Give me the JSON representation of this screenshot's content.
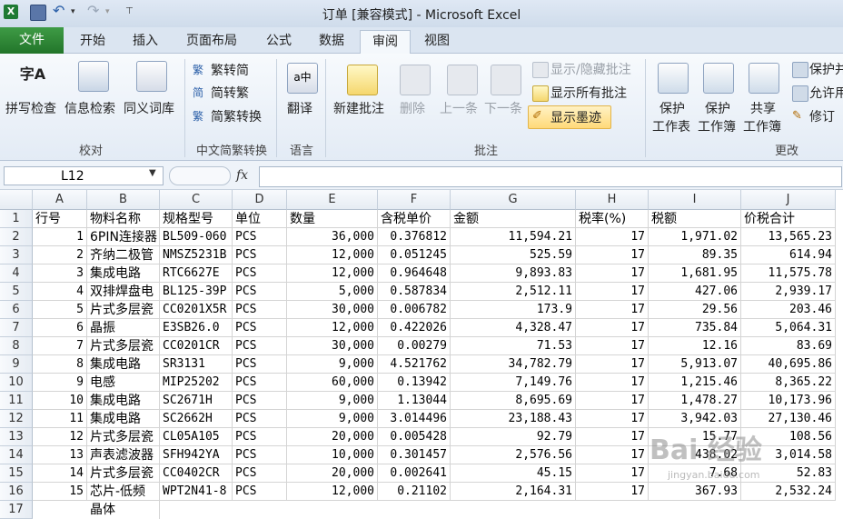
{
  "window": {
    "title": "订单 [兼容模式] - Microsoft Excel"
  },
  "tabs": [
    {
      "label": "文件"
    },
    {
      "label": "开始"
    },
    {
      "label": "插入"
    },
    {
      "label": "页面布局"
    },
    {
      "label": "公式"
    },
    {
      "label": "数据"
    },
    {
      "label": "审阅"
    },
    {
      "label": "视图"
    }
  ],
  "ribbon": {
    "proofing": {
      "spell": "拼写检查",
      "research": "信息检索",
      "thesaurus": "同义词库",
      "group": "校对"
    },
    "chinese": {
      "to_trad": "繁转简",
      "to_simp": "简转繁",
      "convert": "简繁转换",
      "group": "中文简繁转换"
    },
    "language": {
      "translate": "翻译",
      "group": "语言"
    },
    "comments": {
      "new": "新建批注",
      "delete": "删除",
      "prev": "上一条",
      "next": "下一条",
      "show_hide": "显示/隐藏批注",
      "show_all": "显示所有批注",
      "show_ink": "显示墨迹",
      "group": "批注"
    },
    "changes": {
      "protect_sheet_1": "保护",
      "protect_sheet_2": "工作表",
      "protect_wb_1": "保护",
      "protect_wb_2": "工作簿",
      "share_wb_1": "共享",
      "share_wb_2": "工作簿",
      "protect_share": "保护并",
      "allow_edit": "允许用",
      "track": "修订",
      "group": "更改"
    }
  },
  "formula_bar": {
    "name_box": "L12",
    "fx": "fx",
    "value": ""
  },
  "grid": {
    "columns": [
      "A",
      "B",
      "C",
      "D",
      "E",
      "F",
      "G",
      "H",
      "I",
      "J"
    ],
    "rows": [
      [
        "行号",
        "物料名称",
        "规格型号",
        "单位",
        "数量",
        "含税单价",
        "金额",
        "税率(%)",
        "税额",
        "价税合计"
      ],
      [
        "1",
        "6PIN连接器",
        "BL509-060",
        "PCS",
        "36,000",
        "0.376812",
        "11,594.21",
        "17",
        "1,971.02",
        "13,565.23"
      ],
      [
        "2",
        "齐纳二极管",
        "NMSZ5231B",
        "PCS",
        "12,000",
        "0.051245",
        "525.59",
        "17",
        "89.35",
        "614.94"
      ],
      [
        "3",
        "集成电路",
        "RTC6627E",
        "PCS",
        "12,000",
        "0.964648",
        "9,893.83",
        "17",
        "1,681.95",
        "11,575.78"
      ],
      [
        "4",
        "双排焊盘电",
        "BL125-39P",
        "PCS",
        "5,000",
        "0.587834",
        "2,512.11",
        "17",
        "427.06",
        "2,939.17"
      ],
      [
        "5",
        "片式多层瓷",
        "CC0201X5R",
        "PCS",
        "30,000",
        "0.006782",
        "173.9",
        "17",
        "29.56",
        "203.46"
      ],
      [
        "6",
        "晶振",
        "E3SB26.0",
        "PCS",
        "12,000",
        "0.422026",
        "4,328.47",
        "17",
        "735.84",
        "5,064.31"
      ],
      [
        "7",
        "片式多层瓷",
        "CC0201CR",
        "PCS",
        "30,000",
        "0.00279",
        "71.53",
        "17",
        "12.16",
        "83.69"
      ],
      [
        "8",
        "集成电路",
        "SR3131",
        "PCS",
        "9,000",
        "4.521762",
        "34,782.79",
        "17",
        "5,913.07",
        "40,695.86"
      ],
      [
        "9",
        "电感",
        "MIP25202",
        "PCS",
        "60,000",
        "0.13942",
        "7,149.76",
        "17",
        "1,215.46",
        "8,365.22"
      ],
      [
        "10",
        "集成电路",
        "SC2671H",
        "PCS",
        "9,000",
        "1.13044",
        "8,695.69",
        "17",
        "1,478.27",
        "10,173.96"
      ],
      [
        "11",
        "集成电路",
        "SC2662H",
        "PCS",
        "9,000",
        "3.014496",
        "23,188.43",
        "17",
        "3,942.03",
        "27,130.46"
      ],
      [
        "12",
        "片式多层瓷",
        "CL05A105",
        "PCS",
        "20,000",
        "0.005428",
        "92.79",
        "17",
        "15.77",
        "108.56"
      ],
      [
        "13",
        "声表滤波器",
        "SFH942YA",
        "PCS",
        "10,000",
        "0.301457",
        "2,576.56",
        "17",
        "438.02",
        "3,014.58"
      ],
      [
        "14",
        "片式多层瓷",
        "CC0402CR",
        "PCS",
        "20,000",
        "0.002641",
        "45.15",
        "17",
        "7.68",
        "52.83"
      ],
      [
        "15",
        "芯片-低频",
        "WPT2N41-8",
        "PCS",
        "12,000",
        "0.21102",
        "2,164.31",
        "17",
        "367.93",
        "2,532.24"
      ]
    ],
    "row_numbers": [
      "1",
      "2",
      "3",
      "4",
      "5",
      "6",
      "7",
      "8",
      "9",
      "10",
      "11",
      "12",
      "13",
      "14",
      "15",
      "16"
    ],
    "partial_row_17": "晶体"
  },
  "watermark": {
    "text": "Bai 经验",
    "sub": "jingyan.baidu.com"
  },
  "colors": {
    "file_tab": "#2b7d31",
    "ribbon_bg": "#e3ebf5",
    "title_bg": "#dfe8f4"
  }
}
